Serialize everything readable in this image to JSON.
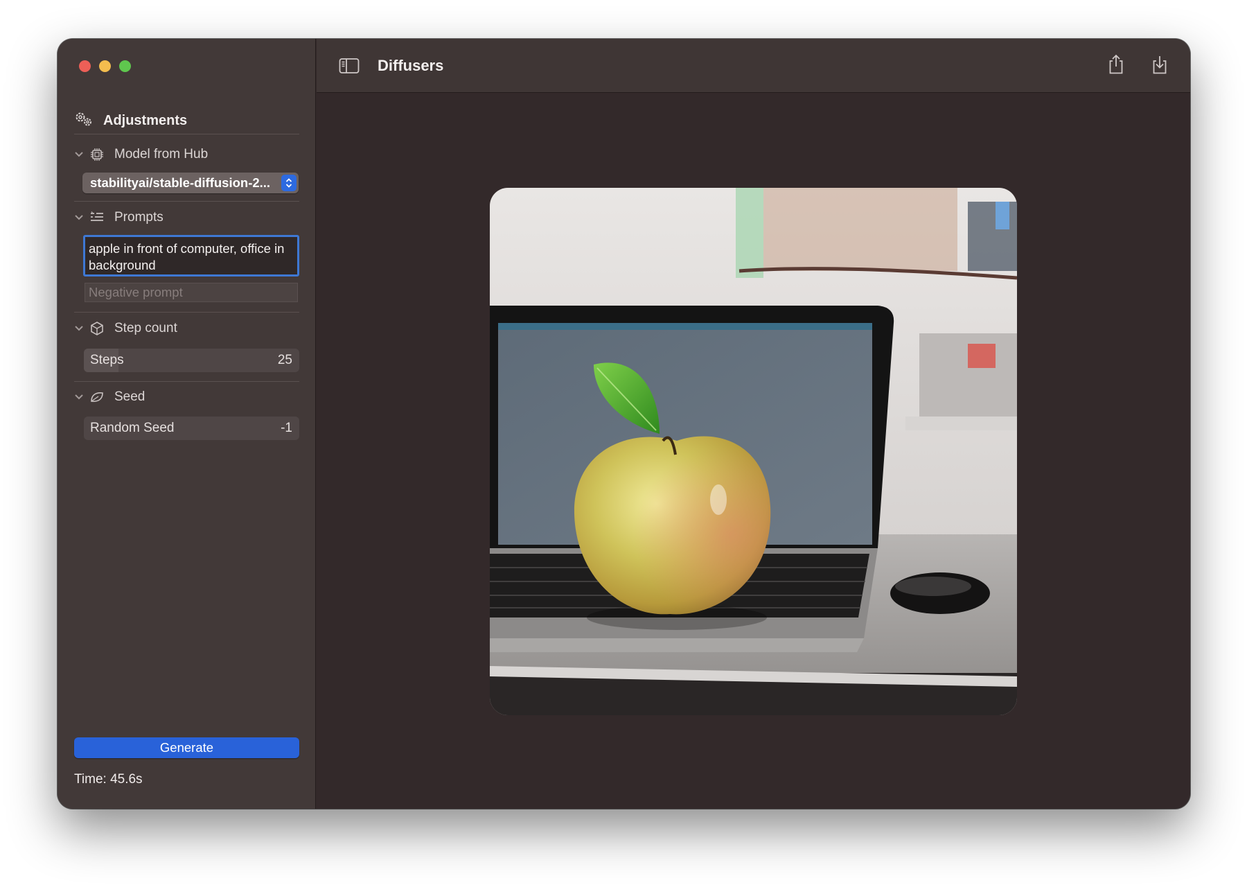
{
  "window": {
    "title": "Diffusers"
  },
  "sidebar": {
    "heading": "Adjustments",
    "model": {
      "label": "Model from Hub",
      "selected": "stabilityai/stable-diffusion-2..."
    },
    "prompts": {
      "label": "Prompts",
      "prompt_value": "apple in front of computer, office in background",
      "negative_placeholder": "Negative prompt"
    },
    "step_count": {
      "label": "Step count",
      "field_label": "Steps",
      "value": "25",
      "fill_fraction": 0.16
    },
    "seed": {
      "label": "Seed",
      "field_label": "Random Seed",
      "value": "-1"
    },
    "generate_label": "Generate",
    "time_label": "Time: 45.6s"
  },
  "icons": {
    "adjustments": "gears-icon",
    "model": "cpu-chip-icon",
    "prompts": "text-list-icon",
    "step_count": "cube-icon",
    "seed": "leaf-icon",
    "sidebar_toggle": "sidebar-toggle-icon",
    "share": "share-icon",
    "save": "download-icon"
  },
  "colors": {
    "accent": "#2962d9",
    "focus_ring": "#3e78d4",
    "sidebar_bg": "#423938",
    "canvas_bg": "#33292a"
  }
}
